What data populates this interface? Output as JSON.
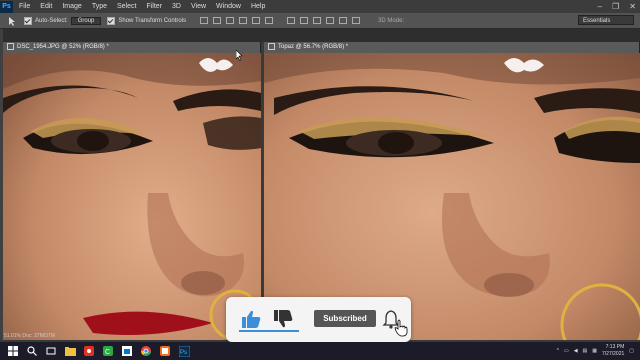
{
  "app": {
    "logo": "Ps"
  },
  "menu": [
    "File",
    "Edit",
    "Image",
    "Type",
    "Select",
    "Filter",
    "3D",
    "View",
    "Window",
    "Help"
  ],
  "window_controls": [
    "–",
    "❐",
    "✕"
  ],
  "options": {
    "auto_select_label": "Auto-Select:",
    "auto_select_value": "Group",
    "transform_label": "Show Transform Controls",
    "mode_3d": "3D Mode:",
    "workspace": "Essentials"
  },
  "tabs": {
    "left": "DSC_1954.JPG @ 52% (RGB/8) *",
    "right": "Topaz @ 56.7% (RGB/8) *"
  },
  "status": {
    "left": "51.01%   Doc: 37M/37M"
  },
  "popup": {
    "subscribe_label": "Subscribed"
  },
  "taskbar": {
    "time": "7:13 PM",
    "date": "7/27/2021"
  },
  "colors": {
    "accent": "#3b8ed8",
    "skin": "#c48a68"
  }
}
